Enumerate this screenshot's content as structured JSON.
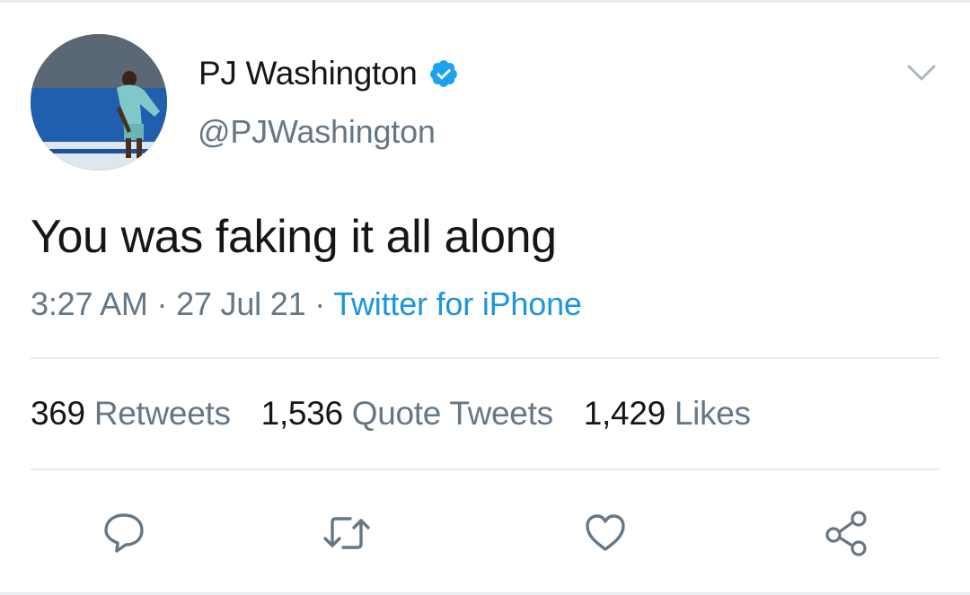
{
  "tweet": {
    "author": {
      "display_name": "PJ Washington",
      "handle": "@PJWashington",
      "verified": true,
      "avatar_icon": "avatar-photo"
    },
    "text": "You was faking it all along",
    "time": "3:27 AM",
    "date": "27 Jul 21",
    "separator": "·",
    "source": "Twitter for iPhone",
    "stats": {
      "retweets": {
        "count": "369",
        "label": "Retweets"
      },
      "quote_tweets": {
        "count": "1,536",
        "label": "Quote Tweets"
      },
      "likes": {
        "count": "1,429",
        "label": "Likes"
      }
    },
    "actions": [
      {
        "name": "reply",
        "icon": "speech-bubble-icon"
      },
      {
        "name": "retweet",
        "icon": "retweet-arrows-icon"
      },
      {
        "name": "like",
        "icon": "heart-icon"
      },
      {
        "name": "share",
        "icon": "share-nodes-icon"
      }
    ]
  },
  "colors": {
    "text": "#14171a",
    "secondary": "#657786",
    "link": "#1b95e0",
    "verified": "#1da1f2",
    "divider": "#e6ecf0"
  }
}
